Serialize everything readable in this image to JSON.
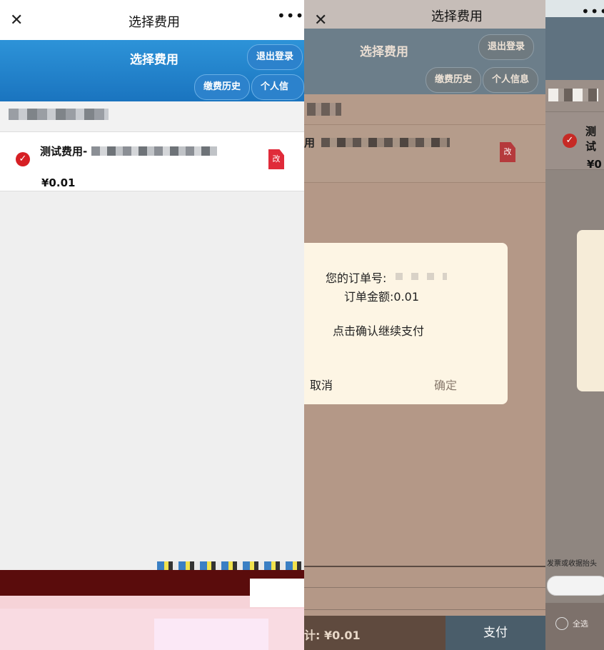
{
  "screens": [
    {
      "window_title": "选择费用",
      "header": {
        "title": "选择费用",
        "logout_label": "退出登录",
        "history_label": "缴费历史",
        "profile_label": "个人信息"
      },
      "fee_item": {
        "name": "测试费用-",
        "price": "¥0.01",
        "edit_icon_label": "改"
      }
    },
    {
      "window_title": "选择费用",
      "header": {
        "title": "选择费用",
        "logout_label": "退出登录",
        "history_label": "缴费历史",
        "profile_label": "个人信息"
      },
      "fee_item": {
        "name_fragment": "用",
        "edit_icon_label": "改"
      },
      "dialog": {
        "order_number_label": "您的订单号:",
        "order_amount": "订单金额:0.01",
        "prompt": "点击确认继续支付",
        "cancel_label": "取消",
        "confirm_label": "确定"
      },
      "footer": {
        "total": "计: ¥0.01",
        "pay_label": "支付"
      }
    },
    {
      "fee_item": {
        "name_fragment": "测试",
        "price_fragment": "¥0"
      },
      "invoice_label": "发票或收据抬头",
      "select_all_label": "全选"
    }
  ],
  "colors": {
    "header_blue": "#1f80c9",
    "check_red": "#d61f24",
    "dialog_bg": "#fdf5e4",
    "overlay": "#b49887"
  },
  "icons": {
    "close": "close-icon",
    "more": "more-icon",
    "check": "check-icon",
    "edit": "edit-icon"
  }
}
